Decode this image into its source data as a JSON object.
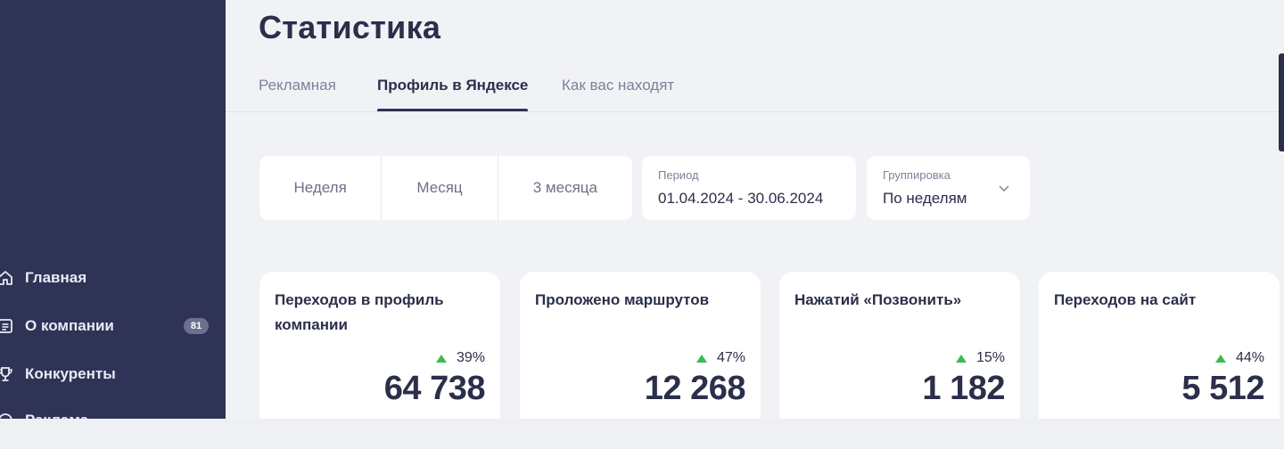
{
  "sidebar": {
    "items": [
      {
        "label": "Главная",
        "icon": "home-icon"
      },
      {
        "label": "О компании",
        "icon": "document-icon",
        "badge": "81"
      },
      {
        "label": "Конкуренты",
        "icon": "trophy-icon"
      },
      {
        "label": "Реклама",
        "icon": "ads-icon"
      }
    ]
  },
  "header": {
    "title": "Статистика",
    "tabs": [
      {
        "label": "Рекламная"
      },
      {
        "label": "Профиль в Яндексе",
        "active": true
      },
      {
        "label": "Как вас находят"
      }
    ]
  },
  "filters": {
    "periods": [
      "Неделя",
      "Месяц",
      "3 месяца"
    ],
    "period_field": {
      "label": "Период",
      "value": "01.04.2024 - 30.06.2024"
    },
    "grouping_field": {
      "label": "Группировка",
      "value": "По неделям"
    }
  },
  "cards": [
    {
      "title": "Переходов в профиль компании",
      "delta": "39%",
      "value": "64 738"
    },
    {
      "title": "Проложено маршрутов",
      "delta": "47%",
      "value": "12 268"
    },
    {
      "title": "Нажатий «Позвонить»",
      "delta": "15%",
      "value": "1 182"
    },
    {
      "title": "Переходов на сайт",
      "delta": "44%",
      "value": "5 512"
    }
  ],
  "colors": {
    "sidebar_bg": "#2f3356",
    "accent": "#2f3356",
    "positive": "#3cba54"
  }
}
